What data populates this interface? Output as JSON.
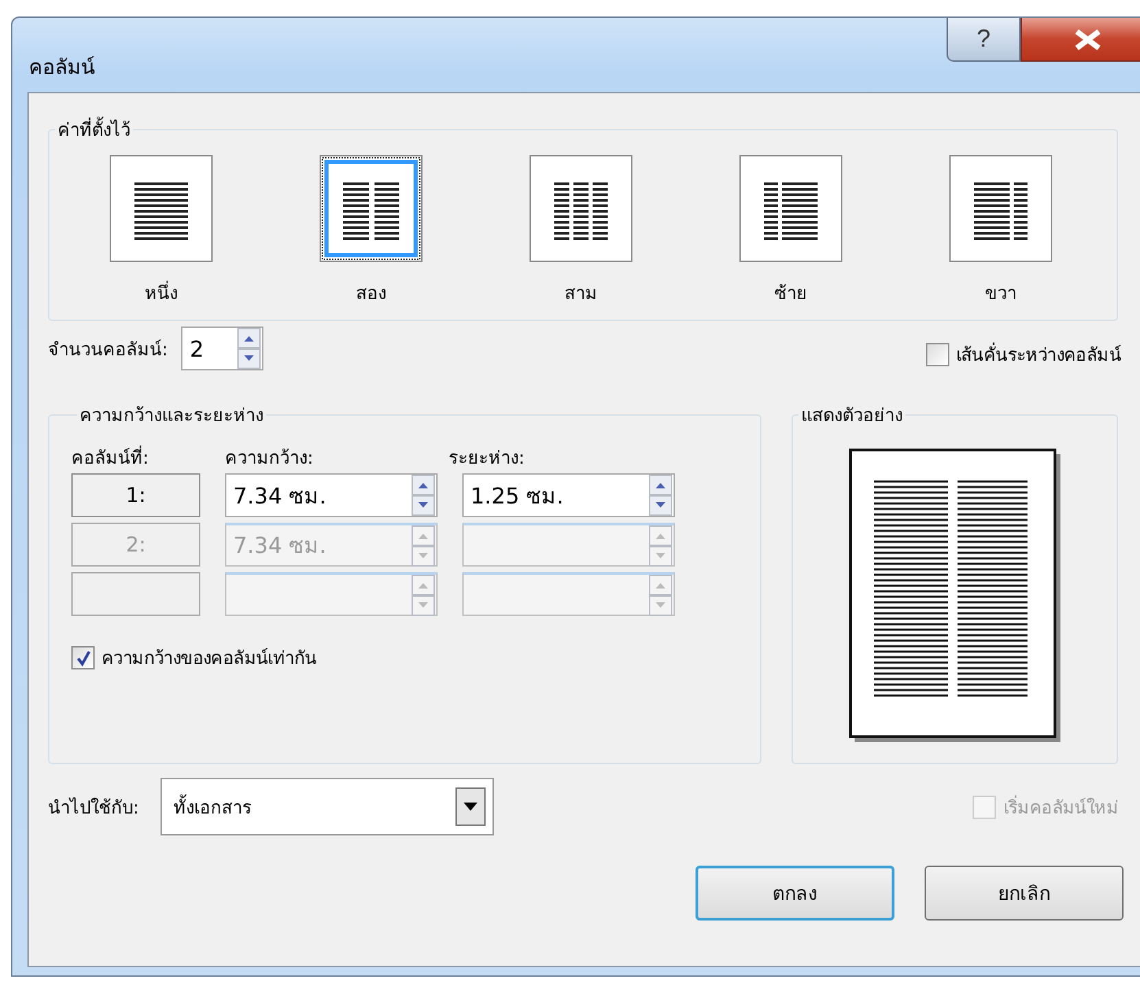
{
  "window": {
    "title": "คอลัมน์",
    "help_label": "?"
  },
  "presets": {
    "legend": "ค่าที่ตั้งไว้",
    "items": [
      {
        "label": "หนึ่ง",
        "kind": "one",
        "selected": false
      },
      {
        "label": "สอง",
        "kind": "two",
        "selected": true
      },
      {
        "label": "สาม",
        "kind": "three",
        "selected": false
      },
      {
        "label": "ซ้าย",
        "kind": "left",
        "selected": false
      },
      {
        "label": "ขวา",
        "kind": "right",
        "selected": false
      }
    ]
  },
  "number_of_columns": {
    "label": "จำนวนคอลัมน์:",
    "value": "2"
  },
  "line_between": {
    "label": "เส้นคั่นระหว่างคอลัมน์",
    "checked": false
  },
  "width_spacing": {
    "legend": "ความกว้างและระยะห่าง",
    "headers": [
      "คอลัมน์ที่:",
      "ความกว้าง:",
      "ระยะห่าง:"
    ],
    "rows": [
      {
        "number": "1:",
        "width": "7.34 ซม.",
        "spacing": "1.25 ซม.",
        "disabled": false
      },
      {
        "number": "2:",
        "width": "7.34 ซม.",
        "disabled": true
      },
      {
        "disabled": true
      }
    ]
  },
  "equal_width": {
    "label": "ความกว้างของคอลัมน์เท่ากัน",
    "checked": true
  },
  "preview": {
    "legend": "แสดงตัวอย่าง"
  },
  "apply_to": {
    "label": "นำไปใช้กับ:",
    "value": "ทั้งเอกสาร"
  },
  "start_new_column": {
    "label": "เริ่มคอลัมน์ใหม่",
    "checked": false,
    "disabled": true
  },
  "buttons": [
    {
      "label": "ตกลง",
      "default": true
    },
    {
      "label": "ยกเลิก",
      "default": false
    }
  ]
}
